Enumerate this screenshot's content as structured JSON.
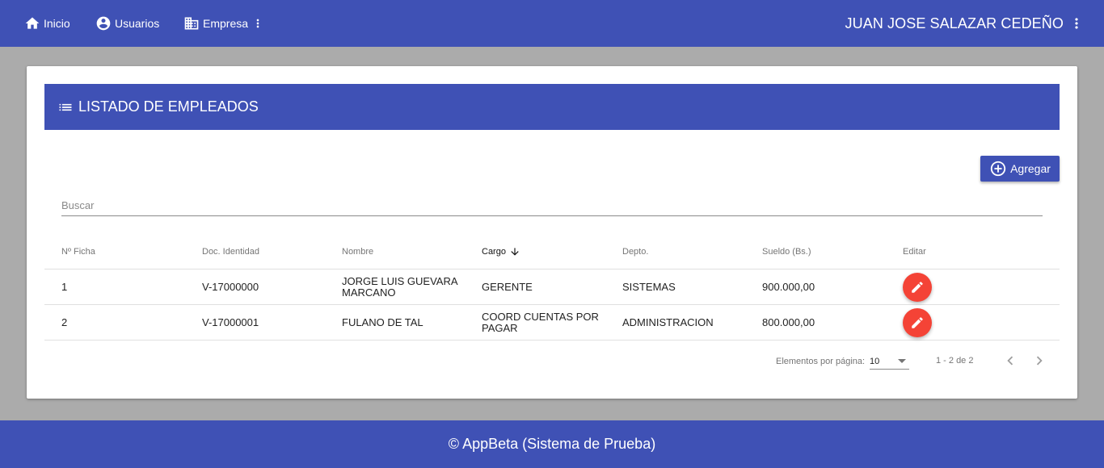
{
  "nav": {
    "inicio": "Inicio",
    "usuarios": "Usuarios",
    "empresa": "Empresa"
  },
  "user": {
    "name": "JUAN JOSE SALAZAR CEDEÑO"
  },
  "card": {
    "title": "LISTADO DE EMPLEADOS",
    "add_label": "Agregar",
    "search_placeholder": "Buscar"
  },
  "table": {
    "headers": [
      "Nº Ficha",
      "Doc. Identidad",
      "Nombre",
      "Cargo",
      "Depto.",
      "Sueldo (Bs.)",
      "Editar"
    ],
    "sorted_column": "Cargo",
    "rows": [
      [
        "1",
        "V-17000000",
        "JORGE LUIS GUEVARA MARCANO",
        "GERENTE",
        "SISTEMAS",
        "900.000,00"
      ],
      [
        "2",
        "V-17000001",
        "FULANO DE TAL",
        "COORD CUENTAS POR PAGAR",
        "ADMINISTRACION",
        "800.000,00"
      ]
    ]
  },
  "paginator": {
    "label": "Elementos por página:",
    "page_size": "10",
    "range": "1 - 2 de 2"
  },
  "footer": {
    "text": "© AppBeta (Sistema de Prueba)"
  },
  "icons": {
    "nav_inicio": "home-icon",
    "nav_usuarios": "account-circle-icon",
    "nav_empresa": "business-icon",
    "menu": "more-vert-icon",
    "title": "list-icon",
    "add": "add-circle-outline-icon",
    "edit": "pencil-icon",
    "sort": "arrow-downward-icon"
  },
  "colors": {
    "primary": "#3f51b5",
    "accent": "#f44336",
    "background": "#ababab"
  }
}
